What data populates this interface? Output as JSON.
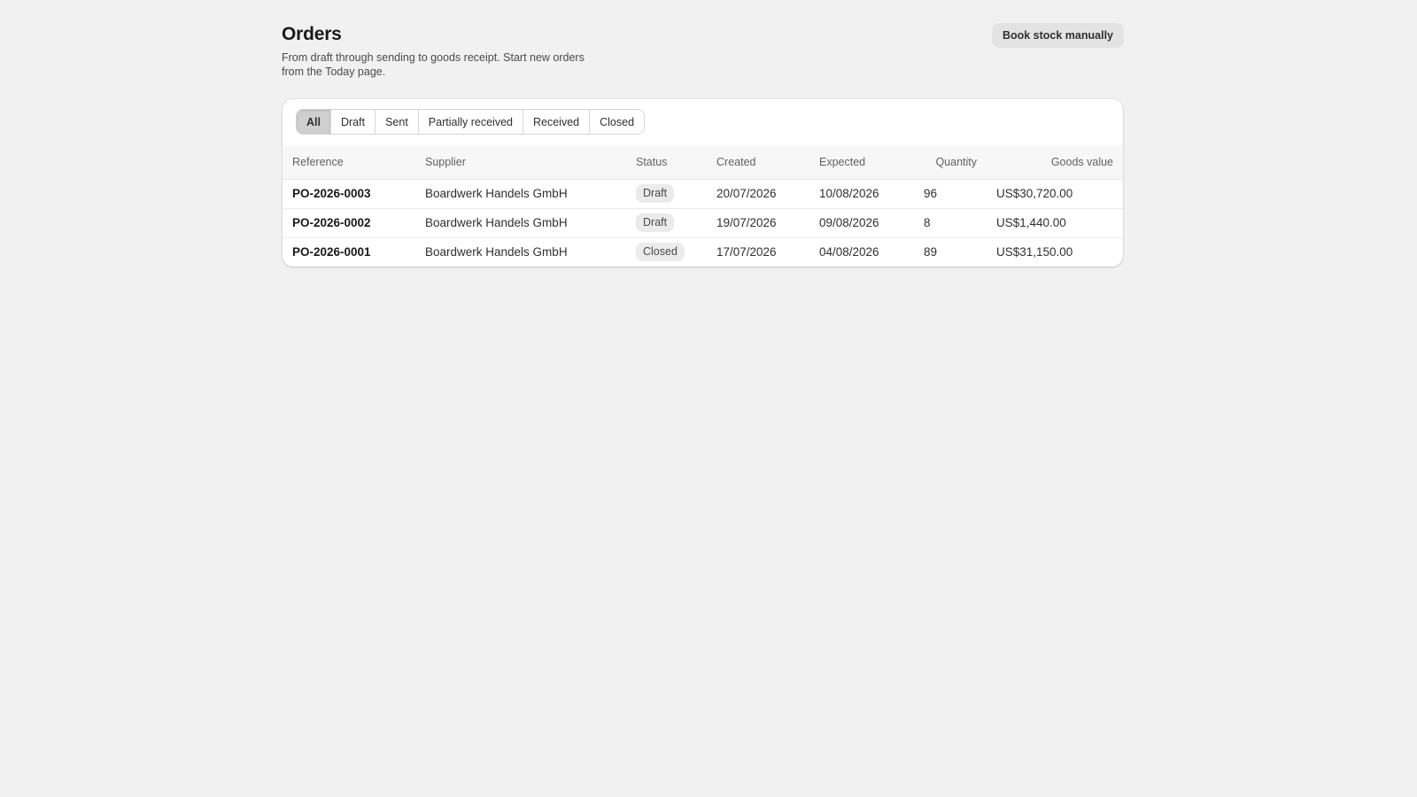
{
  "header": {
    "title": "Orders",
    "subtitle": "From draft through sending to goods receipt. Start new orders from the Today page.",
    "action_label": "Book stock manually"
  },
  "tabs": [
    {
      "label": "All",
      "active": true
    },
    {
      "label": "Draft",
      "active": false
    },
    {
      "label": "Sent",
      "active": false
    },
    {
      "label": "Partially received",
      "active": false
    },
    {
      "label": "Received",
      "active": false
    },
    {
      "label": "Closed",
      "active": false
    }
  ],
  "table": {
    "columns": {
      "reference": "Reference",
      "supplier": "Supplier",
      "status": "Status",
      "created": "Created",
      "expected": "Expected",
      "quantity": "Quantity",
      "goods_value": "Goods value"
    },
    "rows": [
      {
        "reference": "PO-2026-0003",
        "supplier": "Boardwerk Handels GmbH",
        "status": "Draft",
        "created": "20/07/2026",
        "expected": "10/08/2026",
        "quantity": "96",
        "goods_value": "US$30,720.00"
      },
      {
        "reference": "PO-2026-0002",
        "supplier": "Boardwerk Handels GmbH",
        "status": "Draft",
        "created": "19/07/2026",
        "expected": "09/08/2026",
        "quantity": "8",
        "goods_value": "US$1,440.00"
      },
      {
        "reference": "PO-2026-0001",
        "supplier": "Boardwerk Handels GmbH",
        "status": "Closed",
        "created": "17/07/2026",
        "expected": "04/08/2026",
        "quantity": "89",
        "goods_value": "US$31,150.00"
      }
    ]
  }
}
